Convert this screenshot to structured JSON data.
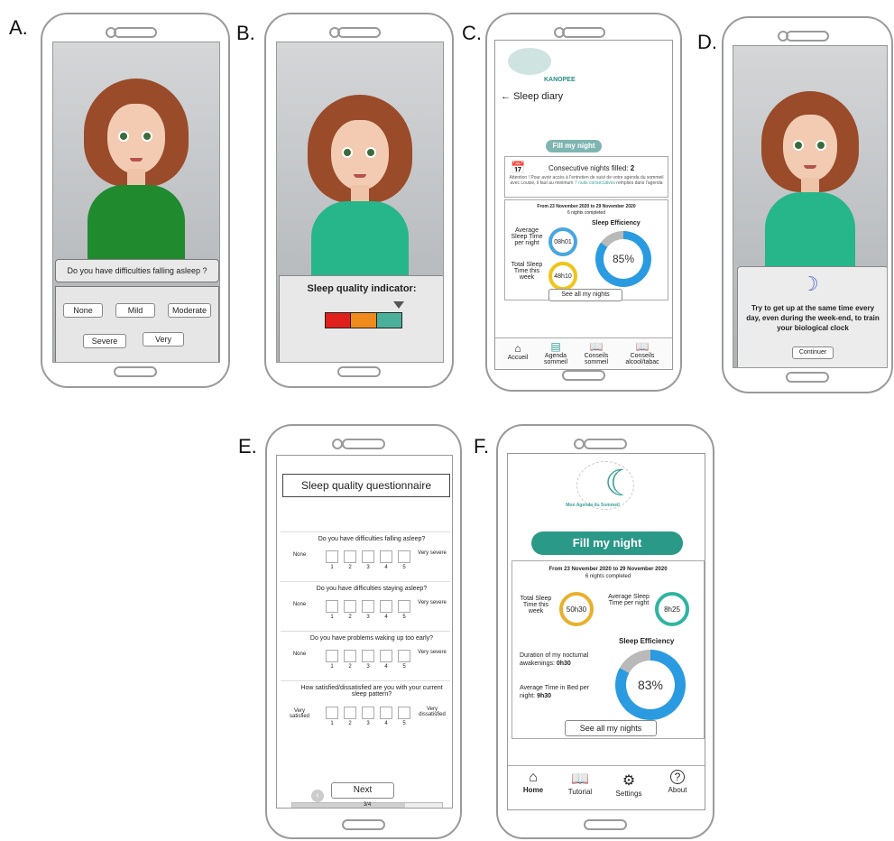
{
  "panel_labels": [
    "A.",
    "B.",
    "C.",
    "D.",
    "E.",
    "F."
  ],
  "panelA": {
    "question": "Do you have difficulties falling asleep ?",
    "options": [
      "None",
      "Mild",
      "Moderate",
      "Severe",
      "Very"
    ]
  },
  "panelB": {
    "indicator_title": "Sleep quality indicator:",
    "indicator_colors": [
      "#e0201a",
      "#f08a1c",
      "#4bb09a"
    ]
  },
  "panelC": {
    "brand": "KANOPEE",
    "back_title": "Sleep diary",
    "fill_button": "Fill my night",
    "consecutive_label": "Consecutive nights filled:",
    "consecutive_value": "2",
    "attention_text": "Attention ! Pour avoir accès à l'entretien de suivi de votre agenda du sommeil avec Louise, il faut au minimum",
    "attention_link": "7 nuits consécutives",
    "attention_tail": "remplies dans l'agenda",
    "date_range": "From 23 November 2020 to 29 November 2020",
    "nights_completed": "6 nights completed",
    "avg_label": "Average Sleep Time per night",
    "avg_value": "08h01",
    "total_label": "Total Sleep Time this week",
    "total_value": "48h10",
    "eff_label": "Sleep Efficiency",
    "eff_value": "85%",
    "eff_percent": 85,
    "see_all": "See all my nights",
    "nav": [
      "Accueil",
      "Agenda sommeil",
      "Conseils sommeil",
      "Conseils alcool/tabac"
    ]
  },
  "panelD": {
    "tip": "Try to get up at the same time every day, even during the week-end, to train your biological clock",
    "continue": "Continuer"
  },
  "panelE": {
    "title": "Sleep quality questionnaire",
    "questions": [
      {
        "q": "Do you have difficulties falling asleep?",
        "left": "None",
        "right": "Very severe"
      },
      {
        "q": "Do you have difficulties staying asleep?",
        "left": "None",
        "right": "Very severe"
      },
      {
        "q": "Do you have problems waking up too early?",
        "left": "None",
        "right": "Very severe"
      },
      {
        "q": "How satisfied/dissatisfied are you with your current sleep pattern?",
        "left": "Very satisfied",
        "right": "Very dissatisfied"
      }
    ],
    "scale": [
      "1",
      "2",
      "3",
      "4",
      "5"
    ],
    "next": "Next",
    "progress": "3/4",
    "progress_fraction": 0.75
  },
  "panelF": {
    "logo_text": "Mon Agenda du Sommeil",
    "fill_button": "Fill my night",
    "date_range": "From 23 November 2020 to 29 November 2020",
    "nights_completed": "6 nights completed",
    "total_label": "Total Sleep Time this week",
    "total_value": "50h30",
    "avg_label": "Average Sleep Time per night",
    "avg_value": "8h25",
    "eff_label": "Sleep Efficiency",
    "eff_value": "83%",
    "eff_percent": 83,
    "awake_label": "Duration of my nocturnal awakenings:",
    "awake_value": "0h30",
    "bed_label": "Average Time in Bed per night:",
    "bed_value": "9h30",
    "see_all": "See all my nights",
    "nav": [
      "Home",
      "Tutorial",
      "Settings",
      "About"
    ]
  }
}
